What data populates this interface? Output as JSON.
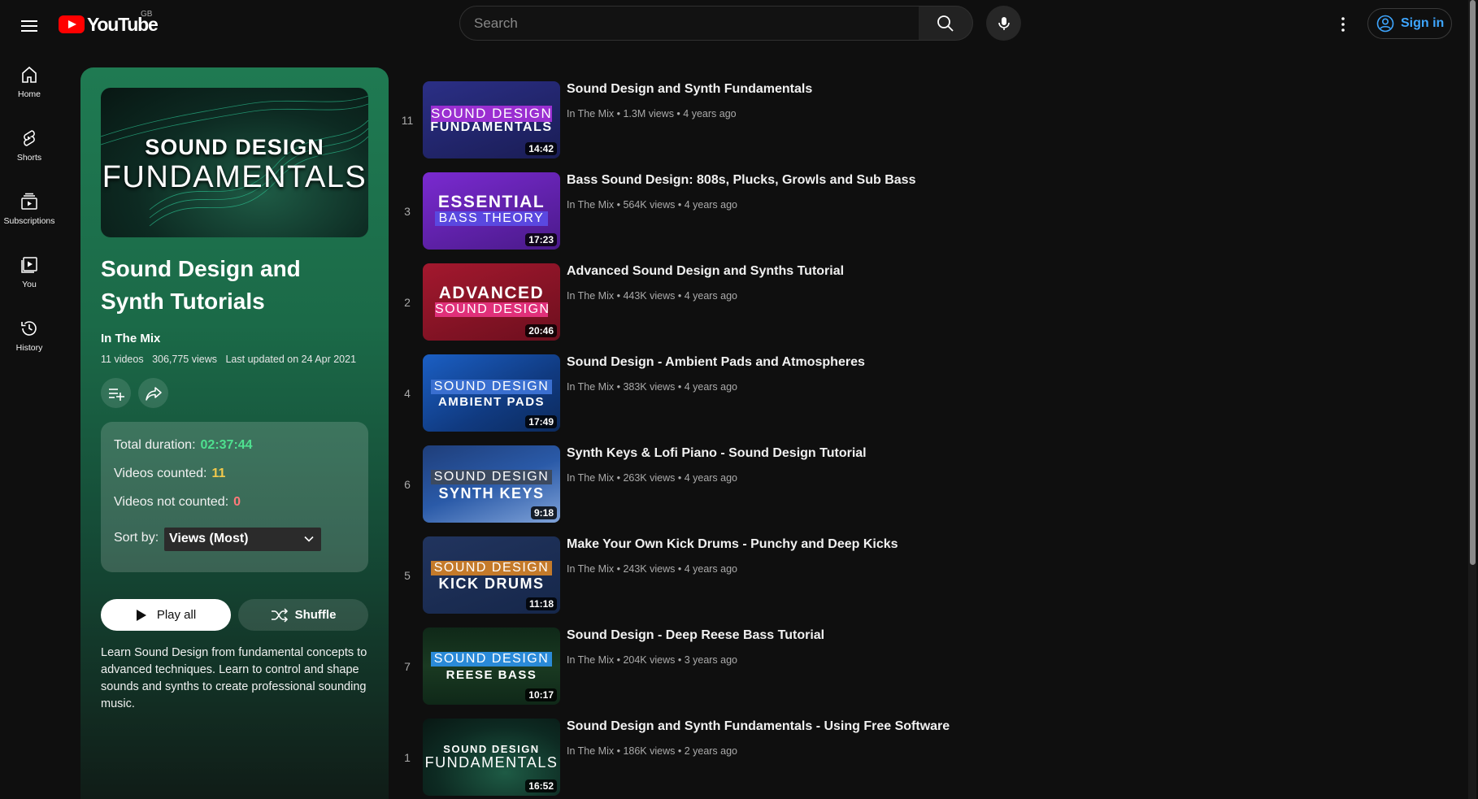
{
  "header": {
    "logo_text": "YouTube",
    "country_code": "GB",
    "search_placeholder": "Search",
    "signin_label": "Sign in"
  },
  "sidenav": [
    {
      "label": "Home",
      "icon": "home-icon"
    },
    {
      "label": "Shorts",
      "icon": "shorts-icon"
    },
    {
      "label": "Subscriptions",
      "icon": "subscriptions-icon"
    },
    {
      "label": "You",
      "icon": "you-icon"
    },
    {
      "label": "History",
      "icon": "history-icon"
    }
  ],
  "playlist": {
    "thumb_line1": "SOUND DESIGN",
    "thumb_line2": "FUNDAMENTALS",
    "title": "Sound Design and Synth Tutorials",
    "owner": "In The Mix",
    "video_count": "11 videos",
    "views": "306,775 views",
    "updated": "Last updated on 24 Apr 2021",
    "description": "Learn Sound Design from fundamental concepts to advanced techniques. Learn to control and shape sounds and synths to create professional sounding music.",
    "play_all_label": "Play all",
    "shuffle_label": "Shuffle"
  },
  "stats": {
    "total_duration_label": "Total duration:",
    "total_duration_value": "02:37:44",
    "videos_counted_label": "Videos counted:",
    "videos_counted_value": "11",
    "videos_not_counted_label": "Videos not counted:",
    "videos_not_counted_value": "0",
    "sort_label": "Sort by:",
    "sort_value": "Views (Most)"
  },
  "colors": {
    "duration_value": "#4ee08f",
    "counted_value": "#f2c94c",
    "not_counted_value": "#ff7a7a"
  },
  "videos": [
    {
      "index": "11",
      "title": "Sound Design and Synth Fundamentals",
      "meta": "In The Mix • 1.3M views • 4 years ago",
      "duration": "14:42",
      "thumb_line1": "SOUND DESIGN",
      "thumb_line2": "FUNDAMENTALS"
    },
    {
      "index": "3",
      "title": "Bass Sound Design: 808s, Plucks, Growls and Sub Bass",
      "meta": "In The Mix • 564K views • 4 years ago",
      "duration": "17:23",
      "thumb_line1": "ESSENTIAL",
      "thumb_line2": "BASS THEORY"
    },
    {
      "index": "2",
      "title": "Advanced Sound Design and Synths Tutorial",
      "meta": "In The Mix • 443K views • 4 years ago",
      "duration": "20:46",
      "thumb_line1": "ADVANCED",
      "thumb_line2": "SOUND DESIGN"
    },
    {
      "index": "4",
      "title": "Sound Design - Ambient Pads and Atmospheres",
      "meta": "In The Mix • 383K views • 4 years ago",
      "duration": "17:49",
      "thumb_line1": "SOUND DESIGN",
      "thumb_line2": "AMBIENT PADS"
    },
    {
      "index": "6",
      "title": "Synth Keys & Lofi Piano - Sound Design Tutorial",
      "meta": "In The Mix • 263K views • 4 years ago",
      "duration": "9:18",
      "thumb_line1": "SOUND DESIGN",
      "thumb_line2": "SYNTH KEYS"
    },
    {
      "index": "5",
      "title": "Make Your Own Kick Drums - Punchy and Deep Kicks",
      "meta": "In The Mix • 243K views • 4 years ago",
      "duration": "11:18",
      "thumb_line1": "SOUND DESIGN",
      "thumb_line2": "KICK DRUMS"
    },
    {
      "index": "7",
      "title": "Sound Design - Deep Reese Bass Tutorial",
      "meta": "In The Mix • 204K views • 3 years ago",
      "duration": "10:17",
      "thumb_line1": "SOUND DESIGN",
      "thumb_line2": "REESE BASS"
    },
    {
      "index": "1",
      "title": "Sound Design and Synth Fundamentals - Using Free Software",
      "meta": "In The Mix • 186K views • 2 years ago",
      "duration": "16:52",
      "thumb_line1": "SOUND DESIGN",
      "thumb_line2": "FUNDAMENTALS"
    }
  ]
}
